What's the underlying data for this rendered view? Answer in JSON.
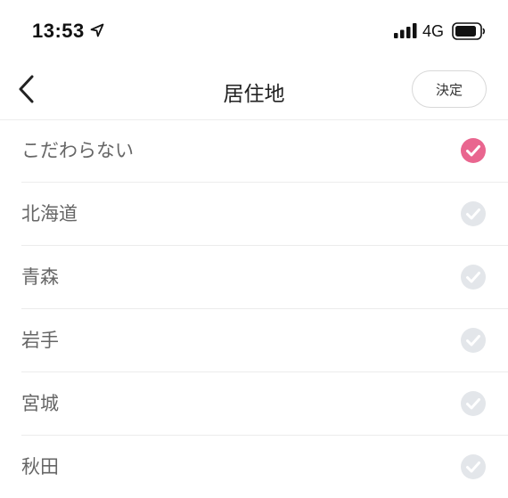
{
  "status_bar": {
    "time": "13:53",
    "network": "4G",
    "icons": [
      "location-arrow-icon",
      "signal-bars-icon",
      "battery-icon"
    ]
  },
  "nav": {
    "title": "居住地",
    "back_icon": "chevron-left-icon",
    "confirm_label": "決定"
  },
  "options": [
    {
      "label": "こだわらない",
      "selected": true
    },
    {
      "label": "北海道",
      "selected": false
    },
    {
      "label": "青森",
      "selected": false
    },
    {
      "label": "岩手",
      "selected": false
    },
    {
      "label": "宮城",
      "selected": false
    },
    {
      "label": "秋田",
      "selected": false
    }
  ],
  "colors": {
    "check_selected": "#e9668f",
    "check_unselected": "#e3e6ea",
    "divider": "#ececec",
    "label_text": "#666666"
  }
}
